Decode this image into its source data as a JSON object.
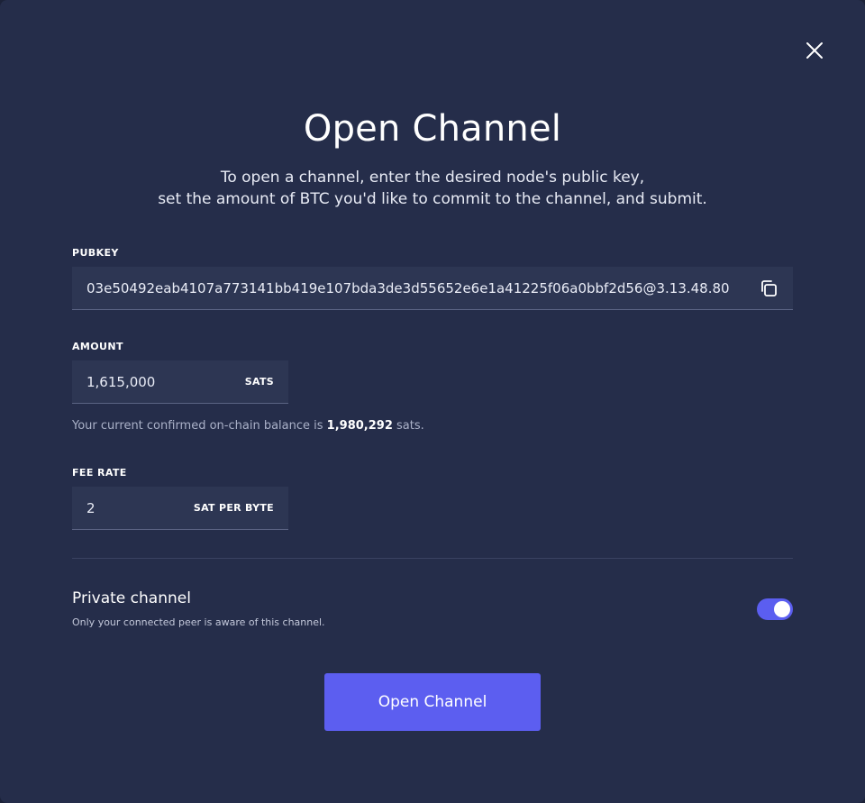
{
  "modal": {
    "title": "Open Channel",
    "description_line1": "To open a channel, enter the desired node's public key,",
    "description_line2": "set the amount of BTC you'd like to commit to the channel, and submit."
  },
  "pubkey": {
    "label": "PUBKEY",
    "value": "03e50492eab4107a773141bb419e107bda3de3d55652e6e1a41225f06a0bbf2d56@3.13.48.80",
    "copy_icon": "copy-icon"
  },
  "amount": {
    "label": "AMOUNT",
    "value": "1,615,000",
    "unit": "SATS",
    "balance_prefix": "Your current confirmed on-chain balance is",
    "balance_value": "1,980,292",
    "balance_suffix": "sats."
  },
  "fee": {
    "label": "FEE RATE",
    "value": "2",
    "unit": "SAT PER BYTE"
  },
  "private_channel": {
    "title": "Private channel",
    "subtitle": "Only your connected peer is aware of this channel.",
    "enabled": true
  },
  "actions": {
    "submit_label": "Open Channel"
  },
  "colors": {
    "background": "#252d4a",
    "accent": "#5c5ef0",
    "field_bg": "#2d3653"
  }
}
